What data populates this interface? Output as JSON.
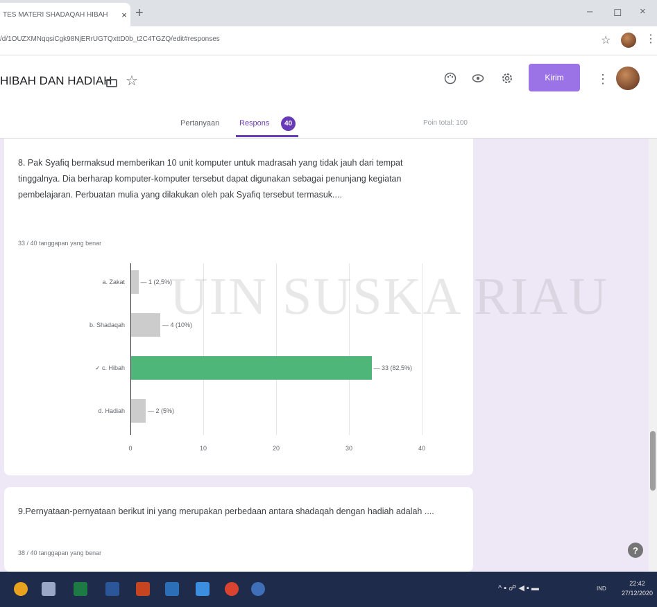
{
  "browser": {
    "tab_title": "TES MATERI SHADAQAH HIBAH",
    "tab_close": "×",
    "new_tab": "+",
    "url": "/d/1OUZXMNqqsiCgk98NjERrUGTQxttD0b_t2C4TGZQ/edit#responses",
    "window_controls": [
      "–",
      "◻",
      "×"
    ]
  },
  "header": {
    "form_title": "HIBAH DAN HADIAH",
    "send_label": "Kirim",
    "tabs": {
      "questions": "Pertanyaan",
      "responses": "Respons",
      "responses_count": "40"
    },
    "points_total": "Poin total: 100"
  },
  "question8": {
    "text": "8. Pak Syafiq bermaksud memberikan 10 unit komputer untuk madrasah yang tidak jauh dari tempat tinggalnya. Dia berharap komputer-komputer tersebut dapat digunakan sebagai penunjang kegiatan pembelajaran. Perbuatan mulia yang dilakukan oleh pak Syafiq tersebut termasuk....",
    "correct_summary": "33 / 40 tanggapan yang benar"
  },
  "chart_data": {
    "type": "bar",
    "orientation": "horizontal",
    "categories": [
      "a. Zakat",
      "b. Shadaqah",
      "✓ c. Hibah",
      "d. Hadiah"
    ],
    "values": [
      1,
      4,
      33,
      2
    ],
    "value_labels": [
      "1 (2,5%)",
      "4 (10%)",
      "33 (82,5%)",
      "2 (5%)"
    ],
    "colors": [
      "#cccccc",
      "#cccccc",
      "#4fb679",
      "#cccccc"
    ],
    "xticks": [
      "0",
      "10",
      "20",
      "30",
      "40"
    ],
    "xlim": [
      0,
      40
    ],
    "grid": true
  },
  "question9": {
    "text": "9.Pernyataan-pernyataan berikut ini yang merupakan perbedaan antara shadaqah dengan hadiah adalah ....",
    "correct_summary": "38 / 40 tanggapan yang benar"
  },
  "watermark": "UIN SUSKA RIAU",
  "taskbar": {
    "tray_lang": "IND",
    "time": "22:42",
    "date": "27/12/2020"
  },
  "icons": {
    "folder": "folder-icon",
    "star": "star-icon",
    "palette": "palette-icon",
    "preview": "eye-icon",
    "settings": "gear-icon",
    "more": "more-vert-icon",
    "help": "help-icon"
  }
}
